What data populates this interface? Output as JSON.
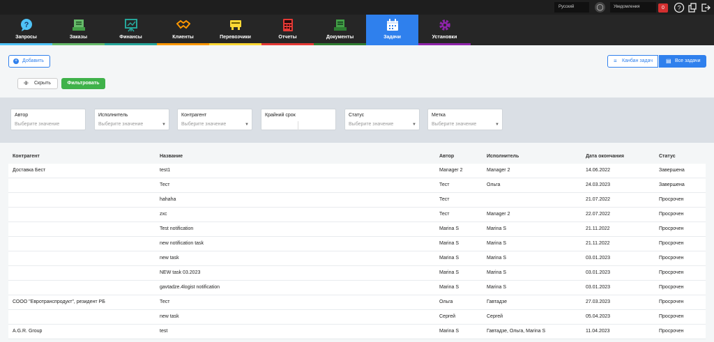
{
  "topbar": {
    "language": "Русский",
    "notifications_label": "Уведомления",
    "notifications_count": "0"
  },
  "nav": {
    "items": [
      {
        "label": "Запросы",
        "color": "#4fc3f7"
      },
      {
        "label": "Заказы",
        "color": "#66bb6a"
      },
      {
        "label": "Финансы",
        "color": "#26a69a"
      },
      {
        "label": "Клиенты",
        "color": "#ff9800"
      },
      {
        "label": "Перевозчики",
        "color": "#fdd835"
      },
      {
        "label": "Отчеты",
        "color": "#e53935"
      },
      {
        "label": "Документы",
        "color": "#2e7d32"
      },
      {
        "label": "Задачи",
        "color": "#2f80ed"
      },
      {
        "label": "Установки",
        "color": "#8e24aa"
      }
    ]
  },
  "toolbar": {
    "add_label": "Добавить",
    "kanban_label": "Канбан задач",
    "all_tasks_label": "Все задачи",
    "hide_label": "Скрыть",
    "filter_label": "Фильтровать"
  },
  "filters": [
    {
      "label": "Автор",
      "placeholder": "Выберите значение"
    },
    {
      "label": "Исполнитель",
      "placeholder": "Выберите значение"
    },
    {
      "label": "Контрагент",
      "placeholder": "Выберите значение"
    },
    {
      "label": "Крайний срок",
      "placeholder": ""
    },
    {
      "label": "Статус",
      "placeholder": "Выберите значение"
    },
    {
      "label": "Метка",
      "placeholder": "Выберите значение"
    }
  ],
  "table": {
    "headers": [
      "Контрагент",
      "Название",
      "Автор",
      "Исполнитель",
      "Дата окончания",
      "Статус"
    ],
    "rows": [
      [
        "Доставка Бест",
        "test1",
        "Manager 2",
        "Manager 2",
        "14.06.2022",
        "Завершена"
      ],
      [
        "",
        "Тест",
        "Тест",
        "Ольга",
        "24.03.2023",
        "Завершена"
      ],
      [
        "",
        "hahaha",
        "Тест",
        "",
        "21.07.2022",
        "Просрочен"
      ],
      [
        "",
        "zxc",
        "Тест",
        "Manager 2",
        "22.07.2022",
        "Просрочен"
      ],
      [
        "",
        "Test notification",
        "Marina S",
        "Marina S",
        "21.11.2022",
        "Просрочен"
      ],
      [
        "",
        "new notification task",
        "Marina S",
        "Marina S",
        "21.11.2022",
        "Просрочен"
      ],
      [
        "",
        "new task",
        "Marina S",
        "Marina S",
        "03.01.2023",
        "Просрочен"
      ],
      [
        "",
        "NEW task 03.2023",
        "Marina S",
        "Marina S",
        "03.01.2023",
        "Просрочен"
      ],
      [
        "",
        "gavtadze.4logist notification",
        "Marina S",
        "Marina S",
        "03.01.2023",
        "Просрочен"
      ],
      [
        "СООО \"Евротранспродукт\", резидент РБ",
        "Тест",
        "Ольга",
        "Гавтадзе",
        "27.03.2023",
        "Просрочен"
      ],
      [
        "",
        "new task",
        "Сергей",
        "Сергей",
        "05.04.2023",
        "Просрочен"
      ],
      [
        "A.G.R. Group",
        "test",
        "Marina S",
        "Гавтадзе, Ольга, Marina S",
        "11.04.2023",
        "Просрочен"
      ]
    ]
  }
}
